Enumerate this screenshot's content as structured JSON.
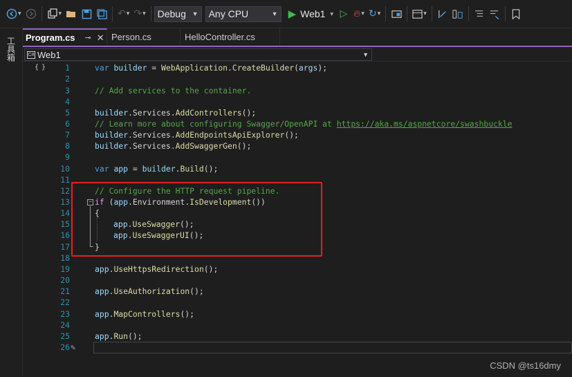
{
  "toolbar": {
    "config_label": "Debug",
    "platform_label": "Any CPU",
    "run_label": "Web1"
  },
  "toolbox": {
    "label": "工具箱"
  },
  "tabs": [
    {
      "label": "Program.cs",
      "pin": "⊸",
      "close": "✕"
    },
    {
      "label": "Person.cs"
    },
    {
      "label": "HelloController.cs"
    }
  ],
  "navbar": {
    "project_label": "Web1"
  },
  "code_lines": [
    {
      "n": "1"
    },
    {
      "n": "2"
    },
    {
      "n": "3"
    },
    {
      "n": "4"
    },
    {
      "n": "5"
    },
    {
      "n": "6"
    },
    {
      "n": "7"
    },
    {
      "n": "8"
    },
    {
      "n": "9"
    },
    {
      "n": "10"
    },
    {
      "n": "11"
    },
    {
      "n": "12"
    },
    {
      "n": "13"
    },
    {
      "n": "14"
    },
    {
      "n": "15"
    },
    {
      "n": "16"
    },
    {
      "n": "17"
    },
    {
      "n": "18"
    },
    {
      "n": "19"
    },
    {
      "n": "20"
    },
    {
      "n": "21"
    },
    {
      "n": "22"
    },
    {
      "n": "23"
    },
    {
      "n": "24"
    },
    {
      "n": "25"
    },
    {
      "n": "26"
    }
  ],
  "code": {
    "l1": [
      "var",
      " ",
      "builder",
      " = ",
      "WebApplication",
      ".",
      "CreateBuilder",
      "(",
      "args",
      ");"
    ],
    "l3": "// Add services to the container.",
    "l5": [
      "builder",
      ".",
      "Services",
      ".",
      "AddControllers",
      "();"
    ],
    "l6a": "// Learn more about configuring Swagger/OpenAPI at ",
    "l6b": "https://aka.ms/aspnetcore/swashbuckle",
    "l7": [
      "builder",
      ".",
      "Services",
      ".",
      "AddEndpointsApiExplorer",
      "();"
    ],
    "l8": [
      "builder",
      ".",
      "Services",
      ".",
      "AddSwaggerGen",
      "();"
    ],
    "l10": [
      "var",
      " ",
      "app",
      " = ",
      "builder",
      ".",
      "Build",
      "();"
    ],
    "l12": "// Configure the HTTP request pipeline.",
    "l13": [
      "if",
      " (",
      "app",
      ".",
      "Environment",
      ".",
      "IsDevelopment",
      "())"
    ],
    "l14": "{",
    "l15": [
      "app",
      ".",
      "UseSwagger",
      "();"
    ],
    "l16": [
      "app",
      ".",
      "UseSwaggerUI",
      "();"
    ],
    "l17": "}",
    "l19": [
      "app",
      ".",
      "UseHttpsRedirection",
      "();"
    ],
    "l21": [
      "app",
      ".",
      "UseAuthorization",
      "();"
    ],
    "l23": [
      "app",
      ".",
      "MapControllers",
      "();"
    ],
    "l25": [
      "app",
      ".",
      "Run",
      "();"
    ]
  },
  "watermark": "CSDN @ts16dmy",
  "colors": {
    "keyword": "#569cd6",
    "variable": "#9cdcfe",
    "method": "#dcdcaa",
    "comment": "#57a64a",
    "line_number": "#2b91af",
    "highlight_box": "#e32222",
    "tab_accent": "#8e65c8"
  }
}
